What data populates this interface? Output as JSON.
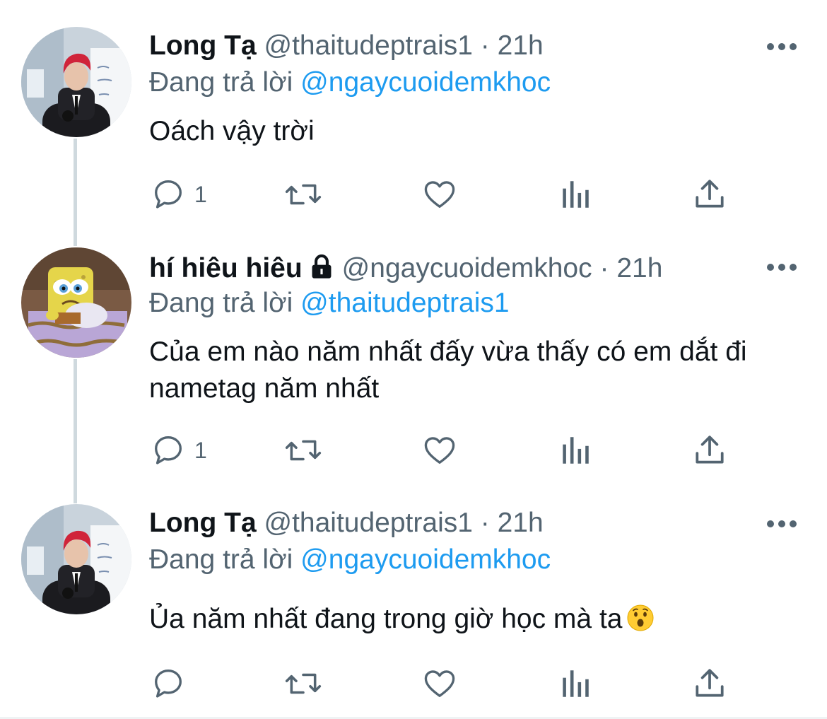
{
  "tweets": [
    {
      "name": "Long Tạ",
      "handle": "@thaitudeptrais1",
      "separator": "·",
      "time": "21h",
      "replying_prefix": "Đang trả lời",
      "replying_to": "@ngaycuoidemkhoc",
      "text": "Oách vậy trời",
      "reply_count": "1",
      "avatar": "person-red-hair-black-suit",
      "locked": false
    },
    {
      "name": "hí hiêu hiêu",
      "handle": "@ngaycuoidemkhoc",
      "separator": "·",
      "time": "21h",
      "replying_prefix": "Đang trả lời",
      "replying_to": "@thaitudeptrais1",
      "text": "Của em nào năm nhất đấy vừa thấy có em dắt đi nametag năm nhất",
      "reply_count": "1",
      "avatar": "crying-sponge-cartoon",
      "locked": true
    },
    {
      "name": "Long Tạ",
      "handle": "@thaitudeptrais1",
      "separator": "·",
      "time": "21h",
      "replying_prefix": "Đang trả lời",
      "replying_to": "@ngaycuoidemkhoc",
      "text": "Ủa năm nhất đang trong giờ học mà ta",
      "emoji": "surprised-face-emoji",
      "reply_count": "",
      "avatar": "person-red-hair-black-suit",
      "locked": false
    }
  ],
  "colors": {
    "text": "#0f1419",
    "secondary": "#536471",
    "link": "#1d9bf0",
    "thread_line": "#cfd9de",
    "divider": "#eff3f4"
  }
}
